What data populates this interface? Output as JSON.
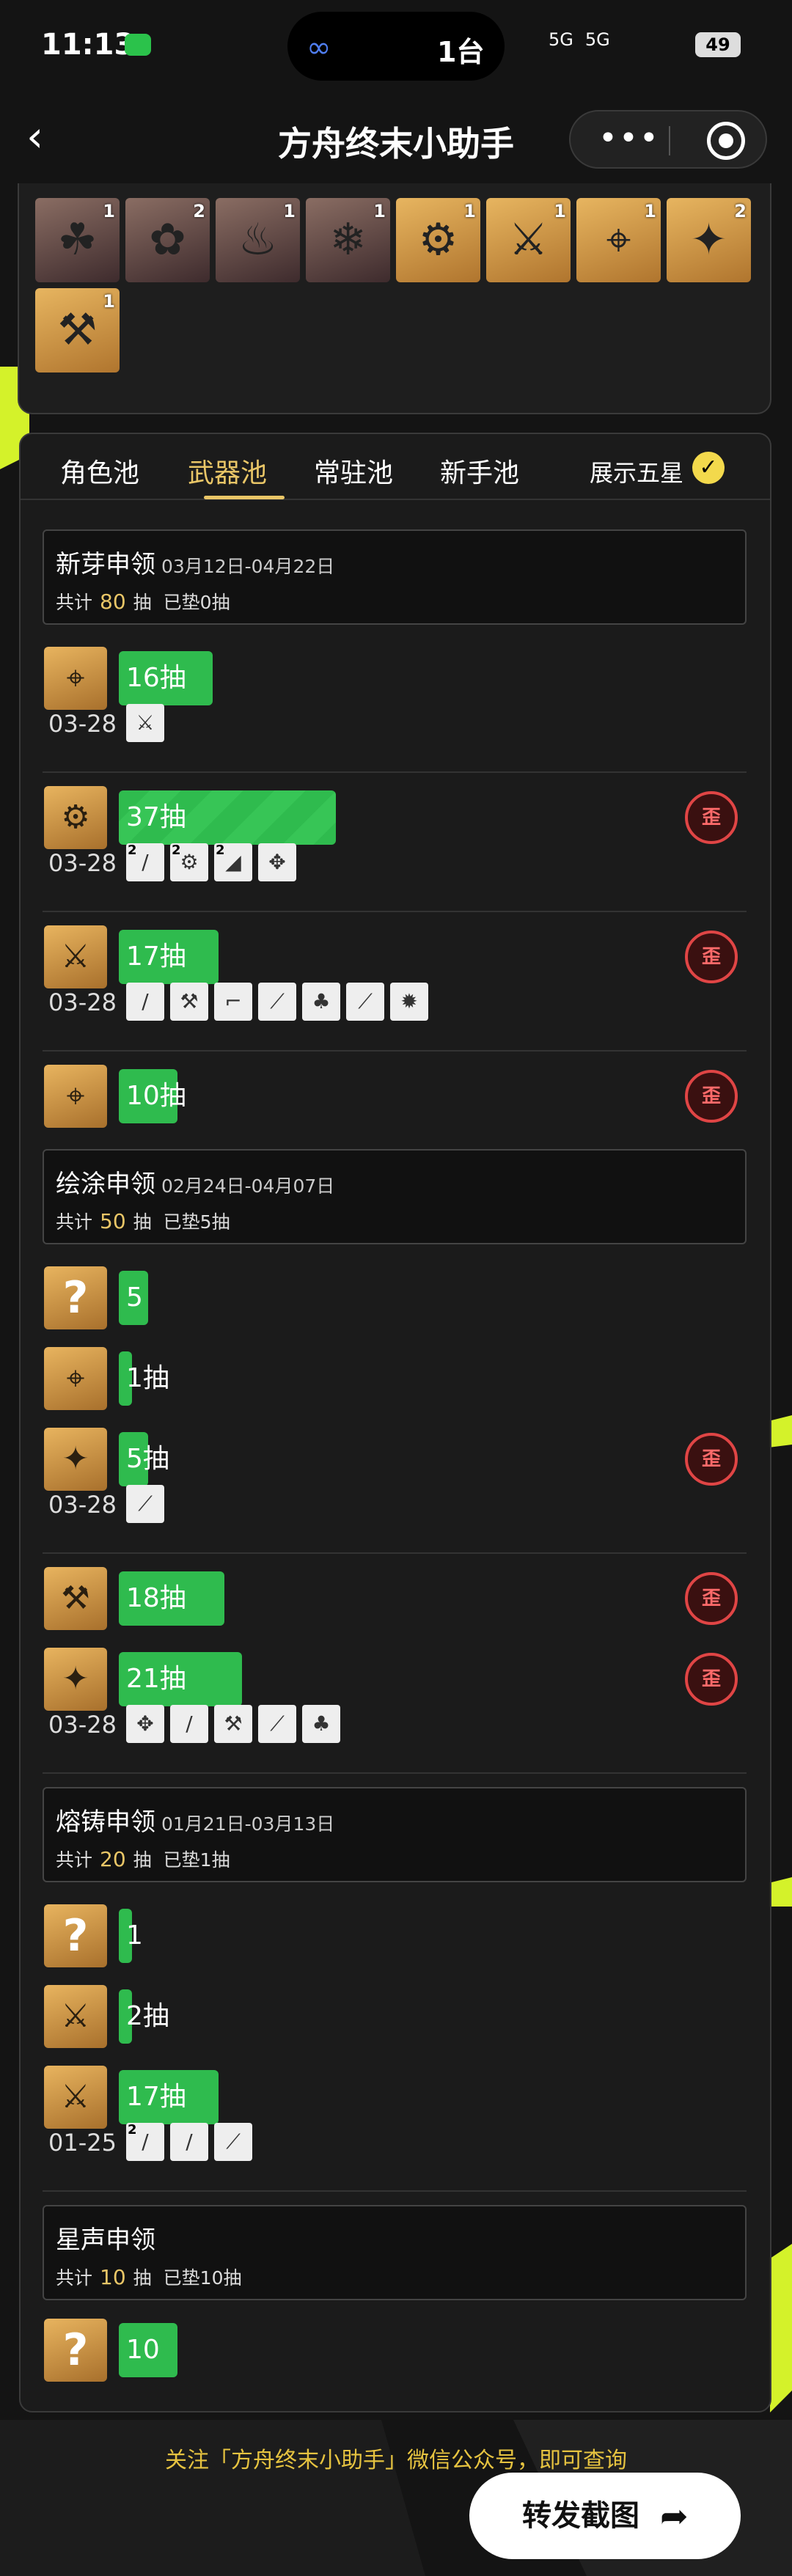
{
  "status": {
    "time": "11:13",
    "island_text": "1台",
    "network_left": "5G",
    "network_right": "5G",
    "battery": "49"
  },
  "nav": {
    "back": "‹",
    "title": "方舟终末小助手",
    "more_icon": "•••"
  },
  "summary_tiles": [
    {
      "type": "char",
      "count": "1",
      "glyph": "☘"
    },
    {
      "type": "char",
      "count": "2",
      "glyph": "✿"
    },
    {
      "type": "char",
      "count": "1",
      "glyph": "♨"
    },
    {
      "type": "char",
      "count": "1",
      "glyph": "❄"
    },
    {
      "type": "weapon",
      "count": "1",
      "glyph": "⚙"
    },
    {
      "type": "weapon",
      "count": "1",
      "glyph": "⚔"
    },
    {
      "type": "weapon",
      "count": "1",
      "glyph": "⌖"
    },
    {
      "type": "weapon",
      "count": "2",
      "glyph": "✦"
    },
    {
      "type": "weapon",
      "count": "1",
      "glyph": "⚒"
    }
  ],
  "tabs": [
    {
      "label": "角色池",
      "active": false
    },
    {
      "label": "武器池",
      "active": true
    },
    {
      "label": "常驻池",
      "active": false
    },
    {
      "label": "新手池",
      "active": false
    }
  ],
  "toggle": {
    "label": "展示五星",
    "check": "✓"
  },
  "banners": [
    {
      "name": "新芽申领",
      "date": "03月12日-04月22日",
      "total_prefix": "共计",
      "total": "80",
      "total_suffix": "抽",
      "pity": "已垫0抽"
    },
    {
      "name": "绘涂申领",
      "date": "02月24日-04月07日",
      "total_prefix": "共计",
      "total": "50",
      "total_suffix": "抽",
      "pity": "已垫5抽"
    },
    {
      "name": "熔铸申领",
      "date": "01月21日-03月13日",
      "total_prefix": "共计",
      "total": "20",
      "total_suffix": "抽",
      "pity": "已垫1抽"
    },
    {
      "name": "星声申领",
      "date": "",
      "total_prefix": "共计",
      "total": "10",
      "total_suffix": "抽",
      "pity": "已垫10抽"
    }
  ],
  "entries": [
    {
      "bar": "16抽",
      "pulls": 16,
      "glyph": "⌖",
      "date": "03-28",
      "minis": [
        "⚔"
      ],
      "warp": false
    },
    {
      "bar": "37抽",
      "pulls": 37,
      "glyph": "⚙",
      "date": "03-28",
      "minis": [
        "/",
        "⚙",
        "◢",
        "✥"
      ],
      "mini_counts": [
        "2",
        "2",
        "2",
        ""
      ],
      "warp": true
    },
    {
      "bar": "17抽",
      "pulls": 17,
      "glyph": "⚔",
      "date": "03-28",
      "minis": [
        "/",
        "⚒",
        "⌐",
        "⟋",
        "♣",
        "⟋",
        "✹"
      ],
      "warp": true
    },
    {
      "bar": "10抽",
      "pulls": 10,
      "glyph": "⌖",
      "warp": true
    },
    {
      "bar": "5",
      "pulls": 5,
      "glyph": "?",
      "question": true
    },
    {
      "bar": "1抽",
      "pulls": 1,
      "glyph": "⌖"
    },
    {
      "bar": "5抽",
      "pulls": 5,
      "glyph": "✦",
      "date": "03-28",
      "minis": [
        "⟋"
      ],
      "warp": true
    },
    {
      "bar": "18抽",
      "pulls": 18,
      "glyph": "⚒",
      "warp": true
    },
    {
      "bar": "21抽",
      "pulls": 21,
      "glyph": "✦",
      "date": "03-28",
      "minis": [
        "✥",
        "/",
        "⚒",
        "⟋",
        "♣"
      ],
      "warp": true
    },
    {
      "bar": "1",
      "pulls": 1,
      "glyph": "?",
      "question": true
    },
    {
      "bar": "2抽",
      "pulls": 2,
      "glyph": "⚔"
    },
    {
      "bar": "17抽",
      "pulls": 17,
      "glyph": "⚔",
      "date": "01-25",
      "minis": [
        "/",
        "/",
        "⟋"
      ],
      "mini_counts": [
        "2",
        "",
        ""
      ]
    },
    {
      "bar": "10",
      "pulls": 10,
      "glyph": "?",
      "question": true
    }
  ],
  "warp_label": "歪",
  "footer": {
    "note": "关注「方舟终末小助手」微信公众号，即可查询",
    "share": "转发截图",
    "share_icon": "➦"
  },
  "colors": {
    "accent": "#e9c667",
    "bar": "#2fbb4e",
    "warp": "#e04545",
    "deco": "#d4f22a"
  }
}
